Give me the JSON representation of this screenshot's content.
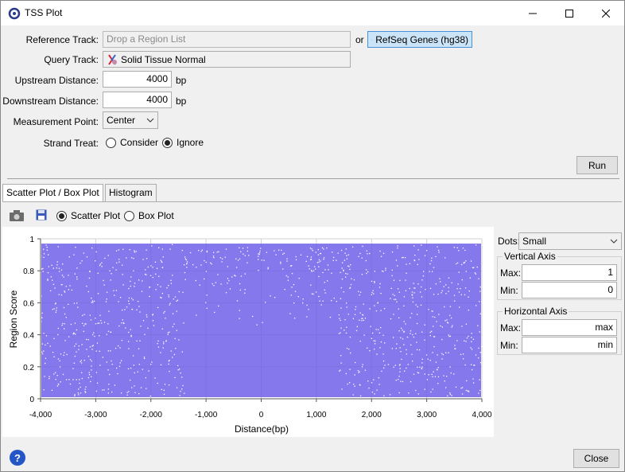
{
  "window": {
    "title": "TSS Plot"
  },
  "form": {
    "reference_track_label": "Reference Track:",
    "reference_placeholder": "Drop a Region List",
    "or_label": "or",
    "reference_option": "RefSeq Genes (hg38)",
    "query_track_label": "Query Track:",
    "query_value": "Solid Tissue Normal",
    "upstream_label": "Upstream Distance:",
    "upstream_value": "4000",
    "downstream_label": "Downstream Distance:",
    "downstream_value": "4000",
    "unit": "bp",
    "measurement_label": "Measurement Point:",
    "measurement_value": "Center",
    "strand_label": "Strand Treat:",
    "strand_options": [
      {
        "label": "Consider",
        "selected": false
      },
      {
        "label": "Ignore",
        "selected": true
      }
    ],
    "run_label": "Run"
  },
  "tabs": [
    {
      "label": "Scatter Plot / Box Plot",
      "active": true
    },
    {
      "label": "Histogram",
      "active": false
    }
  ],
  "plot_toolbar": {
    "options": [
      {
        "label": "Scatter Plot",
        "selected": true
      },
      {
        "label": "Box Plot",
        "selected": false
      }
    ]
  },
  "chart_data": {
    "type": "scatter",
    "xlabel": "Distance(bp)",
    "ylabel": "Region Score",
    "xlim": [
      -4000,
      4000
    ],
    "ylim": [
      0,
      1
    ],
    "x_ticks": [
      "-4,000",
      "-3,000",
      "-2,000",
      "-1,000",
      "0",
      "1,000",
      "2,000",
      "3,000",
      "4,000"
    ],
    "y_ticks": [
      "0",
      "0.2",
      "0.4",
      "0.6",
      "0.8",
      "1"
    ],
    "grid": true,
    "point_color": "#6a5ae8",
    "x_tick_values": [
      -4000,
      -3000,
      -2000,
      -1000,
      0,
      1000,
      2000,
      3000,
      4000
    ],
    "y_tick_values": [
      0,
      0.2,
      0.4,
      0.6,
      0.8,
      1
    ]
  },
  "settings": {
    "dots_label": "Dots:",
    "dots_value": "Small",
    "vertical_axis_title": "Vertical Axis",
    "vertical_max_label": "Max:",
    "vertical_max_value": "1",
    "vertical_min_label": "Min:",
    "vertical_min_value": "0",
    "horizontal_axis_title": "Horizontal Axis",
    "horizontal_max_label": "Max:",
    "horizontal_max_value": "max",
    "horizontal_min_label": "Min:",
    "horizontal_min_value": "min"
  },
  "footer": {
    "close_label": "Close",
    "help_glyph": "?"
  },
  "icons": {
    "app": "app-logo-icon",
    "minimize": "minimize-icon",
    "maximize": "maximize-icon",
    "close": "close-icon",
    "camera": "camera-icon",
    "save": "save-icon",
    "track": "track-icon",
    "help": "help-icon"
  }
}
